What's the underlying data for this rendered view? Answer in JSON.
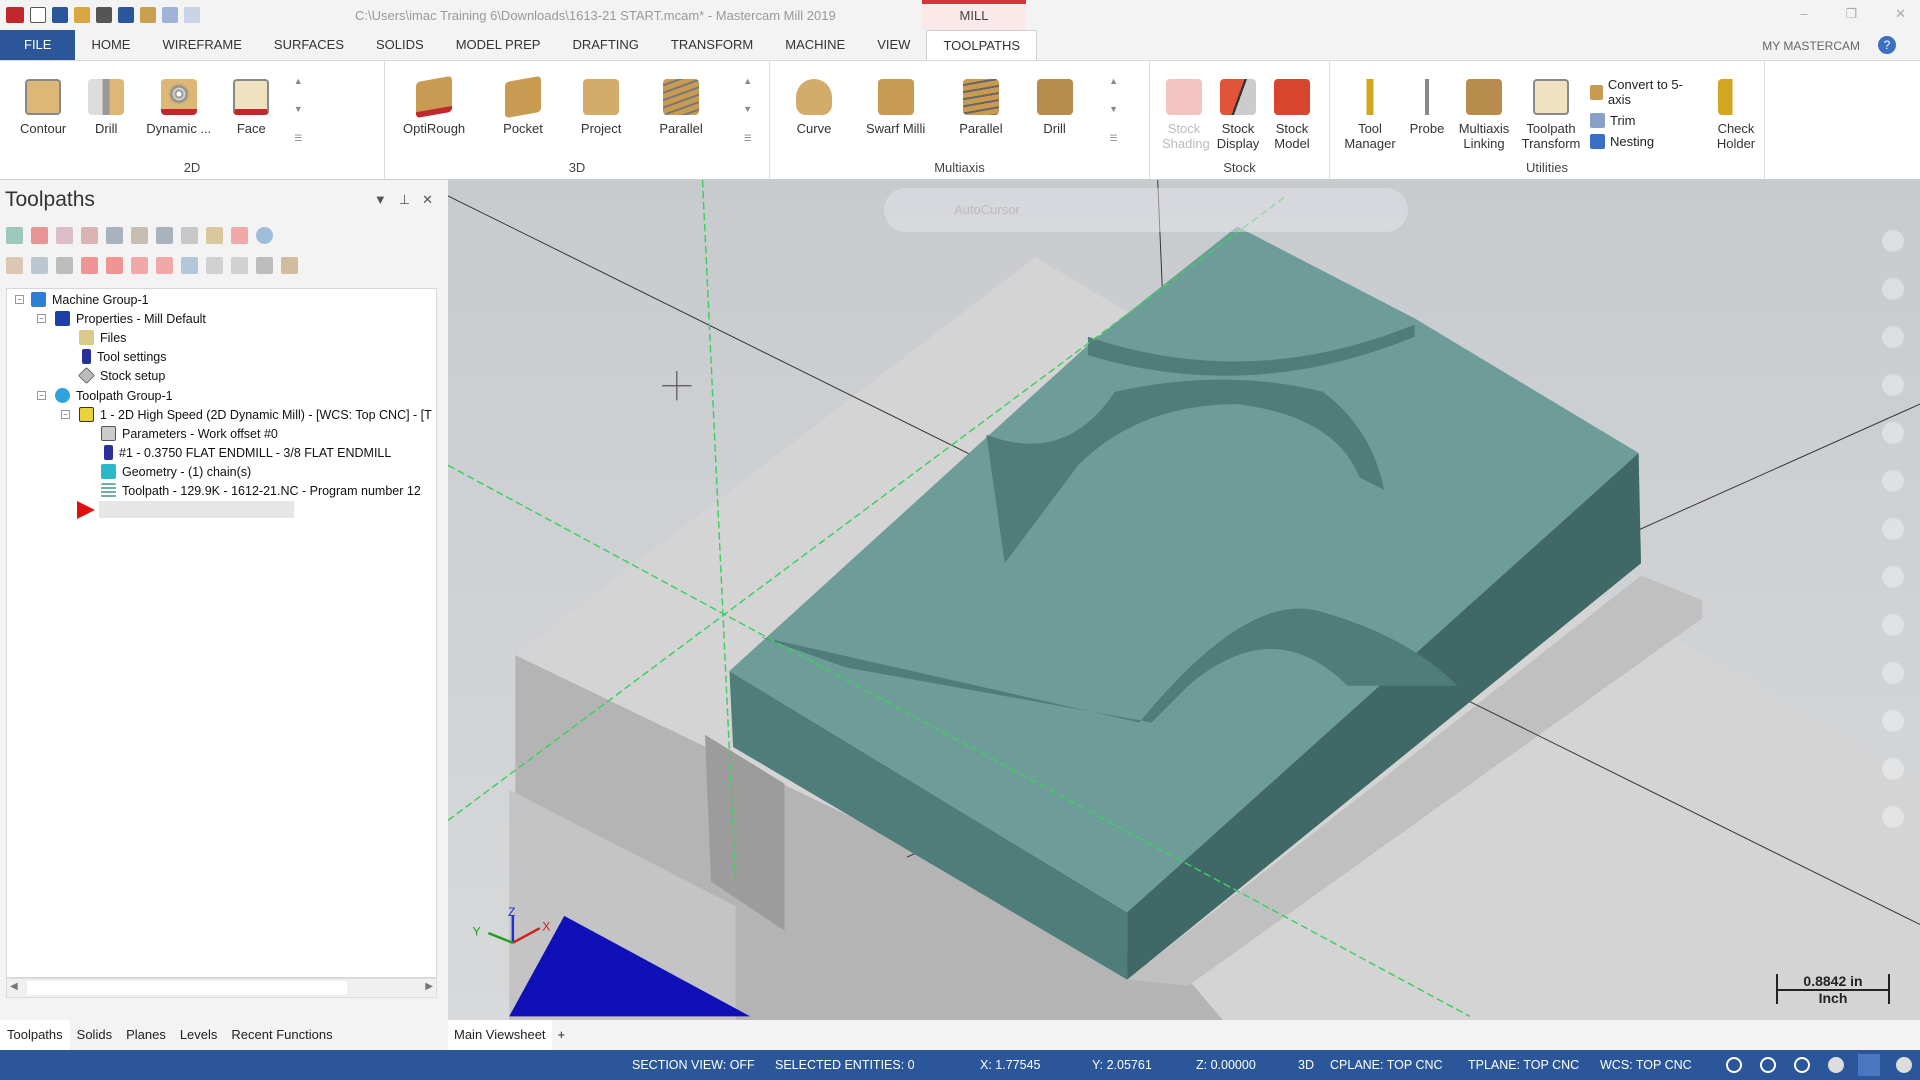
{
  "app": {
    "title": "C:\\Users\\imac Training 6\\Downloads\\1613-21 START.mcam* - Mastercam Mill 2019",
    "context_tab": "MILL",
    "my_mastercam": "MY MASTERCAM",
    "help": "?"
  },
  "tabs": [
    "FILE",
    "HOME",
    "WIREFRAME",
    "SURFACES",
    "SOLIDS",
    "MODEL PREP",
    "DRAFTING",
    "TRANSFORM",
    "MACHINE",
    "VIEW",
    "TOOLPATHS"
  ],
  "active_tab": "TOOLPATHS",
  "ribbon": {
    "g2d": {
      "label": "2D",
      "buttons": [
        "Contour",
        "Drill",
        "Dynamic ...",
        "Face"
      ]
    },
    "g3d": {
      "label": "3D",
      "buttons": [
        "OptiRough",
        "Pocket",
        "Project",
        "Parallel"
      ]
    },
    "multiaxis": {
      "label": "Multiaxis",
      "buttons": [
        "Curve",
        "Swarf Milli",
        "Parallel",
        "Drill"
      ]
    },
    "stock": {
      "label": "Stock",
      "buttons": [
        "Stock Shading",
        "Stock Display",
        "Stock Model"
      ]
    },
    "utilities": {
      "label": "Utilities",
      "buttons": [
        "Tool Manager",
        "Probe",
        "Multiaxis Linking",
        "Toolpath Transform"
      ],
      "small": [
        "Convert to 5-axis",
        "Trim",
        "Nesting"
      ],
      "check": "Check Holder"
    }
  },
  "panel": {
    "title": "Toolpaths",
    "tree": [
      {
        "label": "Machine Group-1",
        "icon": "machine-group-icon",
        "color": "#2d7fd6"
      },
      {
        "label": "Properties - Mill Default",
        "icon": "properties-icon",
        "color": "#1f3fa8"
      },
      {
        "label": "Files",
        "icon": "folder-icon",
        "color": "#d9c98a"
      },
      {
        "label": "Tool settings",
        "icon": "tool-icon",
        "color": "#2a2f9a"
      },
      {
        "label": "Stock setup",
        "icon": "stock-diamond-icon",
        "color": "#bbbbbb"
      },
      {
        "label": "Toolpath Group-1",
        "icon": "toolpath-group-icon",
        "color": "#2fa3e0"
      },
      {
        "label": "1 - 2D High Speed (2D Dynamic Mill) - [WCS: Top CNC] - [T",
        "icon": "open-folder-icon",
        "color": "#e8d43a"
      },
      {
        "label": "Parameters - Work offset #0",
        "icon": "parameters-folder-icon",
        "color": "#cccccc"
      },
      {
        "label": "#1 - 0.3750 FLAT ENDMILL - 3/8 FLAT ENDMILL",
        "icon": "tool-icon",
        "color": "#2a2f9a"
      },
      {
        "label": "Geometry - (1) chain(s)",
        "icon": "geometry-icon",
        "color": "#2bb8c8"
      },
      {
        "label": "Toolpath - 129.9K - 1612-21.NC - Program number 12",
        "icon": "toolpath-icon",
        "color": "#6fb0a8"
      }
    ]
  },
  "bottom_tabs": [
    "Toolpaths",
    "Solids",
    "Planes",
    "Levels",
    "Recent Functions"
  ],
  "viewsheet": {
    "label": "Main Viewsheet",
    "add": "+"
  },
  "viewport": {
    "autocursor": "AutoCursor",
    "scale_value": "0.8842 in",
    "scale_unit": "Inch",
    "axes": {
      "x": "X",
      "y": "Y",
      "z": "Z"
    },
    "model_color": "#6e9c98",
    "base_color": "#c8c8c8"
  },
  "status": {
    "section": "SECTION VIEW: OFF",
    "selected": "SELECTED ENTITIES: 0",
    "x": "X:  1.77545",
    "y": "Y:  2.05761",
    "z": "Z:  0.00000",
    "mode": "3D",
    "cplane": "CPLANE: TOP CNC",
    "tplane": "TPLANE: TOP CNC",
    "wcs": "WCS: TOP CNC"
  }
}
